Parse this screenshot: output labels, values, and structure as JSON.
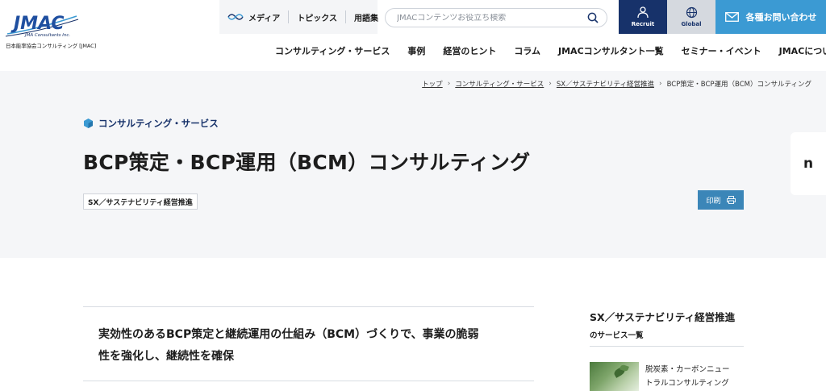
{
  "header": {
    "logo_text": "JMAC",
    "logo_tagline": "JMA Consultants Inc.",
    "logo_sub": "日本能率協会コンサルティング [JMAC]",
    "mini_nav": [
      {
        "label": "メディア",
        "icon": "media-icon"
      },
      {
        "label": "トピックス"
      },
      {
        "label": "用語集"
      }
    ],
    "search": {
      "placeholder": "JMACコンテンツお役立ち検索",
      "value": ""
    },
    "recruit_label": "Recruit",
    "global_label": "Global",
    "contact_label": "各種お問い合わせ",
    "main_nav": [
      "コンサルティング・サービス",
      "事例",
      "経営のヒント",
      "コラム",
      "JMACコンサルタント一覧",
      "セミナー・イベント",
      "JMACについて"
    ],
    "colors": {
      "navy": "#17326a",
      "accent_blue": "#3b9ad3",
      "print_blue": "#3b86b8"
    }
  },
  "hero": {
    "breadcrumb": [
      {
        "label": "トップ",
        "link": true
      },
      {
        "label": "コンサルティング・サービス",
        "link": true
      },
      {
        "label": "SX／サステナビリティ経営推進",
        "link": true
      },
      {
        "label": "BCP策定・BCP運用（BCM）コンサルティング",
        "link": false
      }
    ],
    "category": "コンサルティング・サービス",
    "title": "BCP策定・BCP運用（BCM）コンサルティング",
    "tag": "SX／サステナビリティ経営推進",
    "print_label": "印刷",
    "side_tab": "n"
  },
  "content": {
    "lead_line1": "実効性のあるBCP策定と継続運用の仕組み（BCM）づくりで、事業の脆弱",
    "lead_line2": "性を強化し、継続性を確保"
  },
  "aside": {
    "title": "SX／サステナビリティ経営推進",
    "title_suffix": "のサービス一覧",
    "items": [
      {
        "line1": "脱炭素・カーボンニュー",
        "line2": "トラルコンサルティング"
      }
    ]
  }
}
